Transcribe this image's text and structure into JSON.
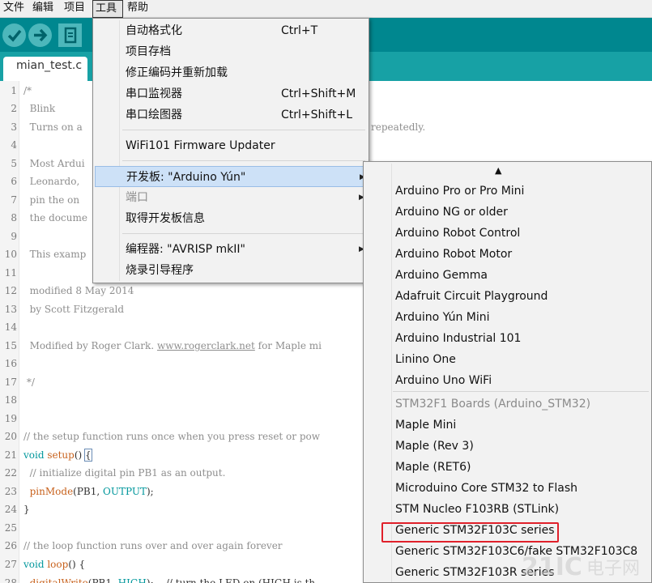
{
  "menubar": {
    "items": [
      {
        "label": "文件"
      },
      {
        "label": "编辑"
      },
      {
        "label": "项目"
      },
      {
        "label": "工具"
      },
      {
        "label": "帮助"
      }
    ]
  },
  "toolbar": {
    "verify_icon": "check-icon",
    "upload_icon": "arrow-right-icon",
    "new_icon": "document-icon",
    "accent_color": "#00878f"
  },
  "tabs": [
    {
      "label": "mian_test.c"
    }
  ],
  "editor": {
    "lines": [
      {
        "n": "1",
        "text": "/*"
      },
      {
        "n": "2",
        "text": "  Blink"
      },
      {
        "n": "3",
        "text": "  Turns on a",
        "tail": "repeatedly."
      },
      {
        "n": "4",
        "text": ""
      },
      {
        "n": "5",
        "text": "  Most Ardui"
      },
      {
        "n": "6",
        "text": "  Leonardo,"
      },
      {
        "n": "7",
        "text": "  pin the on"
      },
      {
        "n": "8",
        "text": "  the docume"
      },
      {
        "n": "9",
        "text": ""
      },
      {
        "n": "10",
        "text": "  This examp"
      },
      {
        "n": "11",
        "text": ""
      },
      {
        "n": "12",
        "text": "  modified 8 May 2014"
      },
      {
        "n": "13",
        "text": "  by Scott Fitzgerald"
      },
      {
        "n": "14",
        "text": ""
      },
      {
        "n": "15",
        "text": "  Modified by Roger Clark. ",
        "link": "www.rogerclark.net",
        "after": " for Maple mi"
      },
      {
        "n": "16",
        "text": ""
      },
      {
        "n": "17",
        "text": " */"
      },
      {
        "n": "18",
        "text": ""
      },
      {
        "n": "19",
        "text": ""
      },
      {
        "n": "20",
        "text": "// the setup function runs once when you press reset or pow"
      },
      {
        "n": "21",
        "kw": "void",
        "fn": " setup",
        "rest": "() ",
        "cursor": "{"
      },
      {
        "n": "22",
        "text": "  // initialize digital pin PB1 as an output."
      },
      {
        "n": "23",
        "fn": "  pinMode",
        "rest": "(PB1, ",
        "const": "OUTPUT",
        "end": ");"
      },
      {
        "n": "24",
        "plain": "}"
      },
      {
        "n": "25",
        "text": ""
      },
      {
        "n": "26",
        "text": "// the loop function runs over and over again forever"
      },
      {
        "n": "27",
        "kw": "void",
        "fn": " loop",
        "rest": "() {"
      },
      {
        "n": "28",
        "fn": "  digitalWrite",
        "rest": "(PB1, ",
        "const": "HIGH",
        "end": ");    // turn the LED on (HIGH is th"
      }
    ]
  },
  "tools_menu": {
    "items": [
      {
        "label": "自动格式化",
        "accel": "Ctrl+T"
      },
      {
        "label": "项目存档",
        "accel": ""
      },
      {
        "label": "修正编码并重新加载",
        "accel": ""
      },
      {
        "label": "串口监视器",
        "accel": "Ctrl+Shift+M"
      },
      {
        "label": "串口绘图器",
        "accel": "Ctrl+Shift+L"
      },
      {
        "label": "WiFi101 Firmware Updater",
        "accel": ""
      },
      {
        "label": "开发板: \"Arduino Yún\"",
        "accel": ""
      },
      {
        "label": "端口",
        "accel": ""
      },
      {
        "label": "取得开发板信息",
        "accel": ""
      },
      {
        "label": "编程器: \"AVRISP mkII\"",
        "accel": ""
      },
      {
        "label": "烧录引导程序",
        "accel": ""
      }
    ]
  },
  "board_menu": {
    "scroll_up": "▲",
    "items": [
      {
        "label": "Arduino Pro or Pro Mini"
      },
      {
        "label": "Arduino NG or older"
      },
      {
        "label": "Arduino Robot Control"
      },
      {
        "label": "Arduino Robot Motor"
      },
      {
        "label": "Arduino Gemma"
      },
      {
        "label": "Adafruit Circuit Playground"
      },
      {
        "label": "Arduino Yún Mini"
      },
      {
        "label": "Arduino Industrial 101"
      },
      {
        "label": "Linino One"
      },
      {
        "label": "Arduino Uno WiFi"
      },
      {
        "label": "STM32F1 Boards (Arduino_STM32)"
      },
      {
        "label": "Maple Mini"
      },
      {
        "label": "Maple (Rev 3)"
      },
      {
        "label": "Maple (RET6)"
      },
      {
        "label": "Microduino Core STM32 to Flash"
      },
      {
        "label": "STM Nucleo F103RB (STLink)"
      },
      {
        "label": "Generic STM32F103C series"
      },
      {
        "label": "Generic STM32F103C6/fake STM32F103C8"
      },
      {
        "label": "Generic STM32F103R series"
      }
    ],
    "highlight_color": "#e0202a"
  },
  "watermark": {
    "text": "电子网",
    "brand": "21IC"
  }
}
